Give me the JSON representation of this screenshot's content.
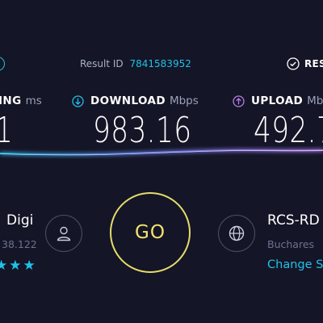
{
  "header": {
    "result_label": "Result ID",
    "result_id": "7841583952",
    "results_button_label": "RES"
  },
  "metrics": {
    "ping": {
      "label": "ING",
      "unit": "ms",
      "value": "1"
    },
    "download": {
      "label": "DOWNLOAD",
      "unit": "Mbps",
      "value": "983.16"
    },
    "upload": {
      "label": "UPLOAD",
      "unit": "Mb",
      "value": "492.7"
    }
  },
  "isp": {
    "name": "Digi",
    "ip": "38.122",
    "rating": "★★★"
  },
  "go_button": {
    "label": "GO"
  },
  "server": {
    "name": "RCS-RD",
    "location": "Buchares",
    "change_label": "Change S"
  },
  "colors": {
    "background": "#141526",
    "accent_cyan": "#1fc2e8",
    "upload_purple": "#b47ee8",
    "go_yellow": "#e6dc6a"
  }
}
